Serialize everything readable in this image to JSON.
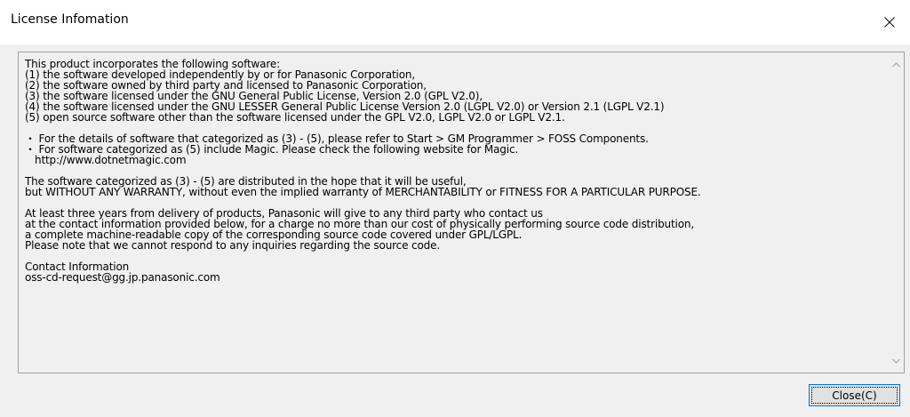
{
  "window": {
    "title": "License Infomation",
    "close_icon": "close-icon"
  },
  "license_text": {
    "lines": [
      "This product incorporates the following software:",
      "(1) the software developed independently by or for Panasonic Corporation,",
      "(2) the software owned by third party and licensed to Panasonic Corporation,",
      "(3) the software licensed under the GNU General Public License, Version 2.0 (GPL V2.0),",
      "(4) the software licensed under the GNU LESSER General Public License Version 2.0 (LGPL V2.0) or Version 2.1 (LGPL V2.1)",
      "(5) open source software other than the software licensed under the GPL V2.0, LGPL V2.0 or LGPL V2.1.",
      "",
      "・ For the details of software that categorized as (3) - (5), please refer to Start > GM Programmer > FOSS Components.",
      "・ For software categorized as (5) include Magic. Please check the following website for Magic.",
      "   http://www.dotnetmagic.com",
      "",
      "The software categorized as (3) - (5) are distributed in the hope that it will be useful,",
      "but WITHOUT ANY WARRANTY, without even the implied warranty of MERCHANTABILITY or FITNESS FOR A PARTICULAR PURPOSE.",
      "",
      "At least three years from delivery of products, Panasonic will give to any third party who contact us",
      "at the contact information provided below, for a charge no more than our cost of physically performing source code distribution,",
      "a complete machine-readable copy of the corresponding source code covered under GPL/LGPL.",
      "Please note that we cannot respond to any inquiries regarding the source code.",
      "",
      "Contact Information",
      "oss-cd-request@gg.jp.panasonic.com"
    ]
  },
  "scrollbar": {
    "up_icon": "chevron-up-icon",
    "down_icon": "chevron-down-icon"
  },
  "buttons": {
    "close_label": "Close(C)"
  }
}
